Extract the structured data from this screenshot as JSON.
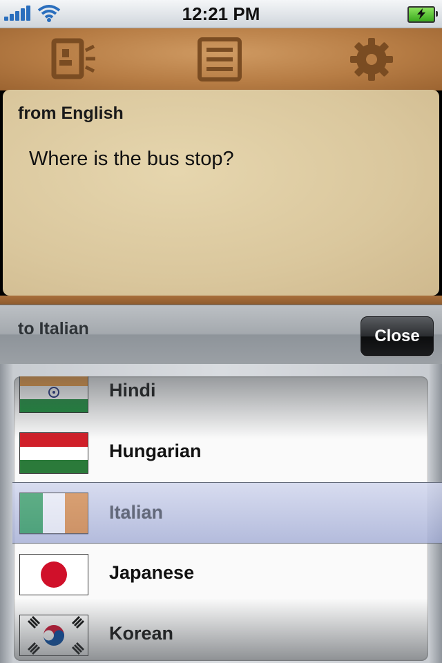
{
  "status_bar": {
    "time": "12:21 PM"
  },
  "toolbar": {
    "icons": [
      "contacts-icon",
      "list-icon",
      "gear-icon"
    ]
  },
  "source": {
    "from_label": "from English",
    "text": "Where is the bus stop?"
  },
  "picker_bar": {
    "to_label": "to Italian",
    "close_label": "Close"
  },
  "languages": [
    {
      "name": "Hindi",
      "flag": "india-flag-icon"
    },
    {
      "name": "Hungarian",
      "flag": "hungary-flag-icon"
    },
    {
      "name": "Italian",
      "flag": "italy-flag-icon",
      "selected": true
    },
    {
      "name": "Japanese",
      "flag": "japan-flag-icon"
    },
    {
      "name": "Korean",
      "flag": "korea-flag-icon"
    }
  ],
  "colors": {
    "accent_leather": "#b77d45",
    "paper": "#dac79d",
    "battery_green": "#3aa91d",
    "selection": "#aeb6dc"
  }
}
